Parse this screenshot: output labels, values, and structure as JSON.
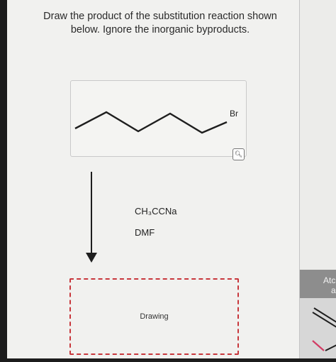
{
  "question": {
    "line1": "Draw the product of the substitution reaction shown",
    "line2": "below. Ignore the inorganic byproducts."
  },
  "molecule": {
    "atom_label": "Br",
    "zoom_icon": "magnifier-icon"
  },
  "reagents": {
    "reagent1": "CH₃CCNa",
    "reagent2": "DMF"
  },
  "drawing": {
    "label": "Drawing"
  },
  "side_panel": {
    "text1": "Atc",
    "text2": "a"
  },
  "colors": {
    "page_bg": "#f1f1ef",
    "drawing_border": "#c8373c",
    "panel_dark": "#8d8d8d"
  }
}
